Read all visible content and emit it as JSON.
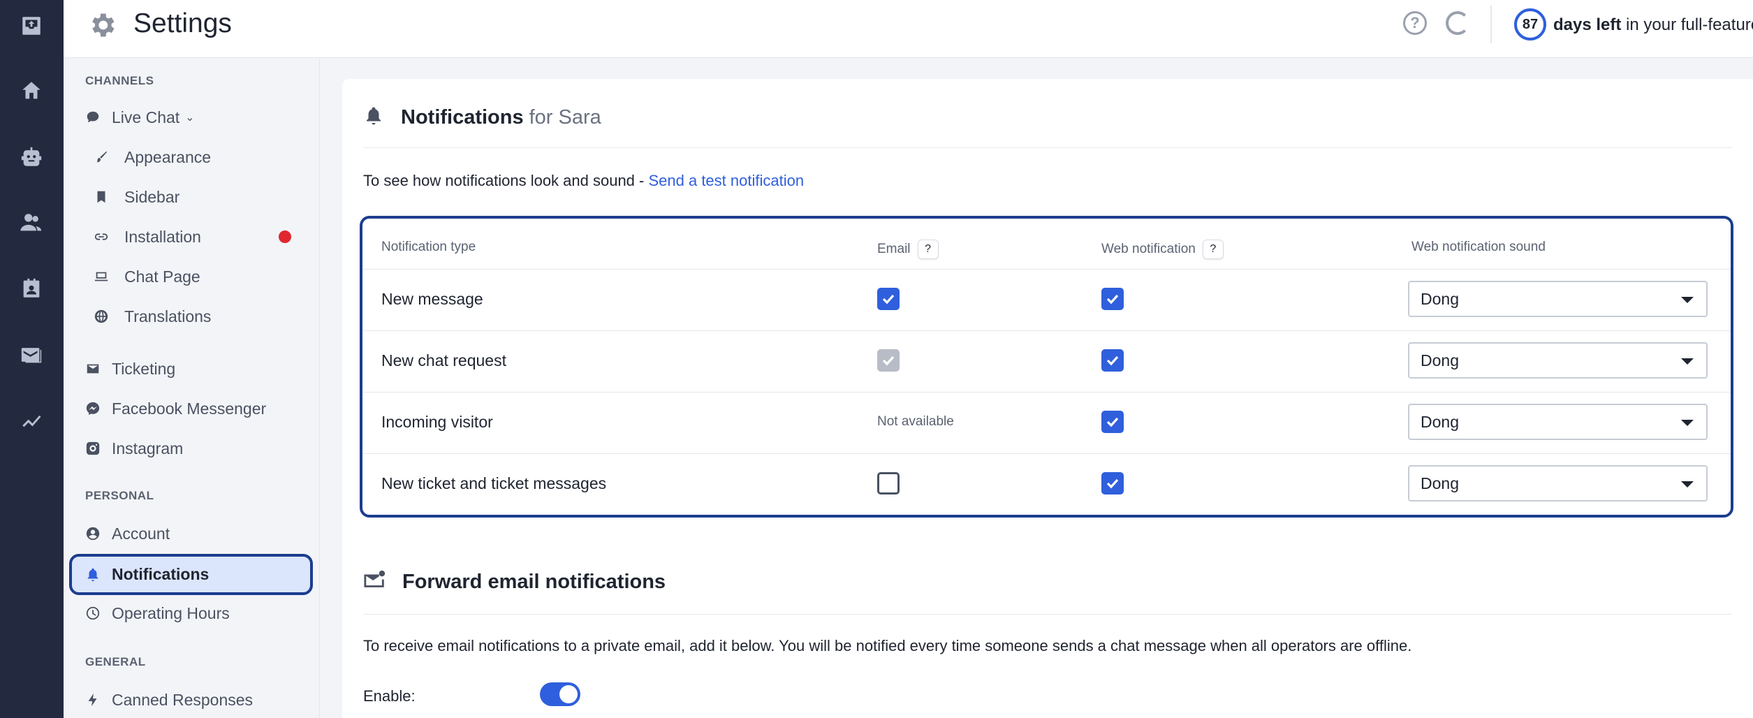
{
  "header": {
    "title": "Settings",
    "help_icon": "question-circle-icon",
    "trial_days": "87",
    "trial_bold": "days left",
    "trial_rest": " in your full-featured"
  },
  "sidebar": {
    "channels_head": "CHANNELS",
    "live_chat": "Live Chat",
    "appearance": "Appearance",
    "sidebar": "Sidebar",
    "installation": "Installation",
    "chat_page": "Chat Page",
    "translations": "Translations",
    "ticketing": "Ticketing",
    "facebook": "Facebook Messenger",
    "instagram": "Instagram",
    "personal_head": "PERSONAL",
    "account": "Account",
    "notifications": "Notifications",
    "operating_hours": "Operating Hours",
    "general_head": "GENERAL",
    "canned": "Canned Responses"
  },
  "notifications": {
    "title": "Notifications",
    "for_user": "for Sara",
    "intro_text": "To see how notifications look and sound - ",
    "intro_link": "Send a test notification",
    "columns": {
      "type": "Notification type",
      "email": "Email",
      "web": "Web notification",
      "sound": "Web notification sound",
      "help": "?"
    },
    "rows": [
      {
        "label": "New message",
        "email": "checked",
        "web": "checked",
        "sound": "Dong"
      },
      {
        "label": "New chat request",
        "email": "checked-disabled",
        "web": "checked",
        "sound": "Dong"
      },
      {
        "label": "Incoming visitor",
        "email": "Not available",
        "web": "checked",
        "sound": "Dong"
      },
      {
        "label": "New ticket and ticket messages",
        "email": "unchecked",
        "web": "checked",
        "sound": "Dong"
      }
    ]
  },
  "forward": {
    "title": "Forward email notifications",
    "description": "To receive email notifications to a private email, add it below. You will be notified every time someone sends a chat message when all operators are offline.",
    "enable_label": "Enable:",
    "enabled": true
  },
  "colors": {
    "rail": "#232a3f",
    "accent": "#2f5fdc",
    "highlight_border": "#1c3d8f",
    "alert": "#e0262f"
  }
}
